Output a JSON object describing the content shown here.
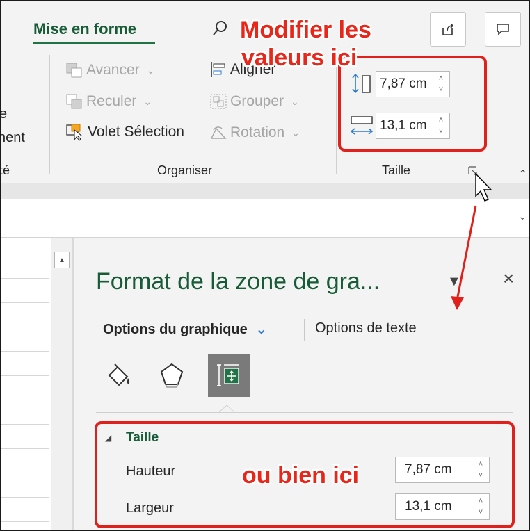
{
  "ribbon": {
    "active_tab": "Mise en forme",
    "left_fragments": [
      "e",
      "nent",
      "té"
    ],
    "organiser": {
      "group_label": "Organiser",
      "avancer": "Avancer",
      "reculer": "Reculer",
      "volet_selection": "Volet Sélection",
      "aligner": "Aligner",
      "grouper": "Grouper",
      "rotation": "Rotation"
    },
    "taille": {
      "group_label": "Taille",
      "height_value": "7,87 cm",
      "width_value": "13,1 cm"
    }
  },
  "pane": {
    "title": "Format de la zone de gra...",
    "tab_active": "Options du graphique",
    "tab_other": "Options de texte",
    "section_title": "Taille",
    "hauteur_label": "Hauteur",
    "largeur_label": "Largeur",
    "hauteur_value": "7,87 cm",
    "largeur_value": "13,1 cm",
    "close_glyph": "×",
    "menu_glyph": "▼"
  },
  "annotations": {
    "top_line1": "Modifier les",
    "top_line2": "valeurs ici",
    "bottom": "ou bien ici"
  },
  "icons": {
    "search": "search-icon",
    "share": "share-icon",
    "comment": "comment-icon",
    "fill": "fill-line-icon",
    "effects": "effects-pentagon-icon",
    "size": "size-properties-icon"
  },
  "colors": {
    "excel_green": "#217346",
    "title_green": "#185c37",
    "annotation_red": "#e8261a"
  }
}
